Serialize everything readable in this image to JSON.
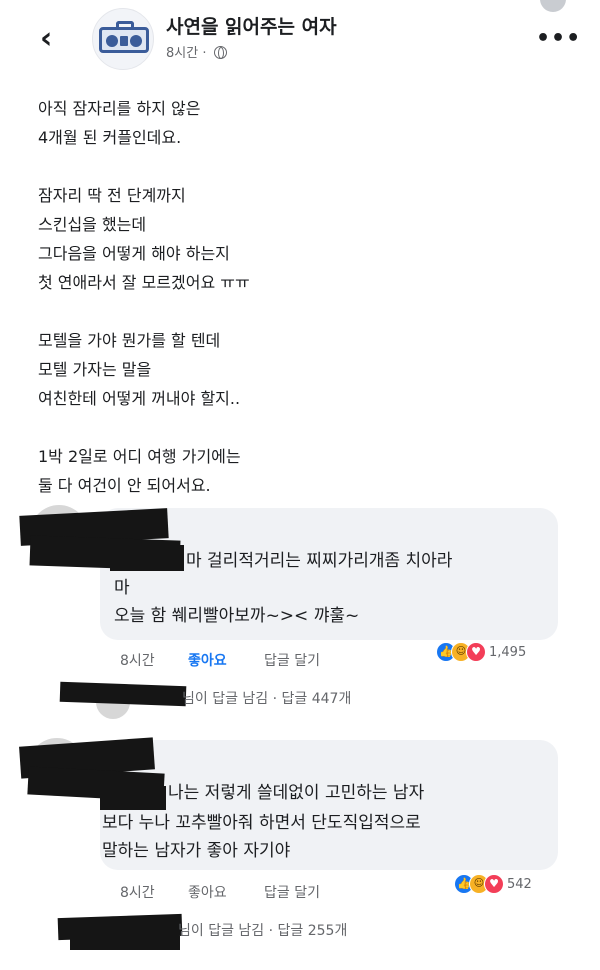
{
  "header": {
    "back_icon": "chevron-left-icon",
    "page_icon": "radio-icon",
    "page_name": "사연을 읽어주는 여자",
    "post_time": "8시간 · ",
    "privacy_icon": "globe-icon",
    "more_icon": "more-horizontal-icon"
  },
  "post": {
    "paragraphs": [
      [
        "아직 잠자리를 하지 않은",
        "4개월 된 커플인데요."
      ],
      [
        "잠자리 딱 전 단계까지",
        "스킨십을 했는데",
        "그다음을 어떻게 해야 하는지",
        "첫 연애라서 잘 모르겠어요 ㅠㅠ"
      ],
      [
        "모텔을 가야 뭔가를 할 텐데",
        "모텔 가자는 말을",
        "여친한테 어떻게 꺼내야 할지.."
      ],
      [
        "1박 2일로 어디 여행 가기에는",
        "둘 다 여건이 안 되어서요."
      ]
    ]
  },
  "comments": [
    {
      "lines": [
        "마 걸리적거리는 찌찌가리개좀 치아라",
        "마",
        "오늘 함 쒜리빨아보까~>< 꺄훌~"
      ],
      "time": "8시간",
      "like_label": "좋아요",
      "reply_label": "답글 달기",
      "reactions": [
        "like",
        "haha",
        "love"
      ],
      "reaction_count": "1,495",
      "replies_text": "님이 답글 남김 · 답글 447개"
    },
    {
      "lines": [
        "나는 저렇게 쓸데없이 고민하는 남자",
        "보다 누나 꼬추빨아줘 하면서 단도직입적으로",
        "말하는 남자가 좋아 자기야"
      ],
      "time": "8시간",
      "like_label": "좋아요",
      "reply_label": "답글 달기",
      "reactions": [
        "like",
        "haha",
        "love"
      ],
      "reaction_count": "542",
      "replies_text": "님이 답글 남김 · 답글 255개"
    }
  ]
}
